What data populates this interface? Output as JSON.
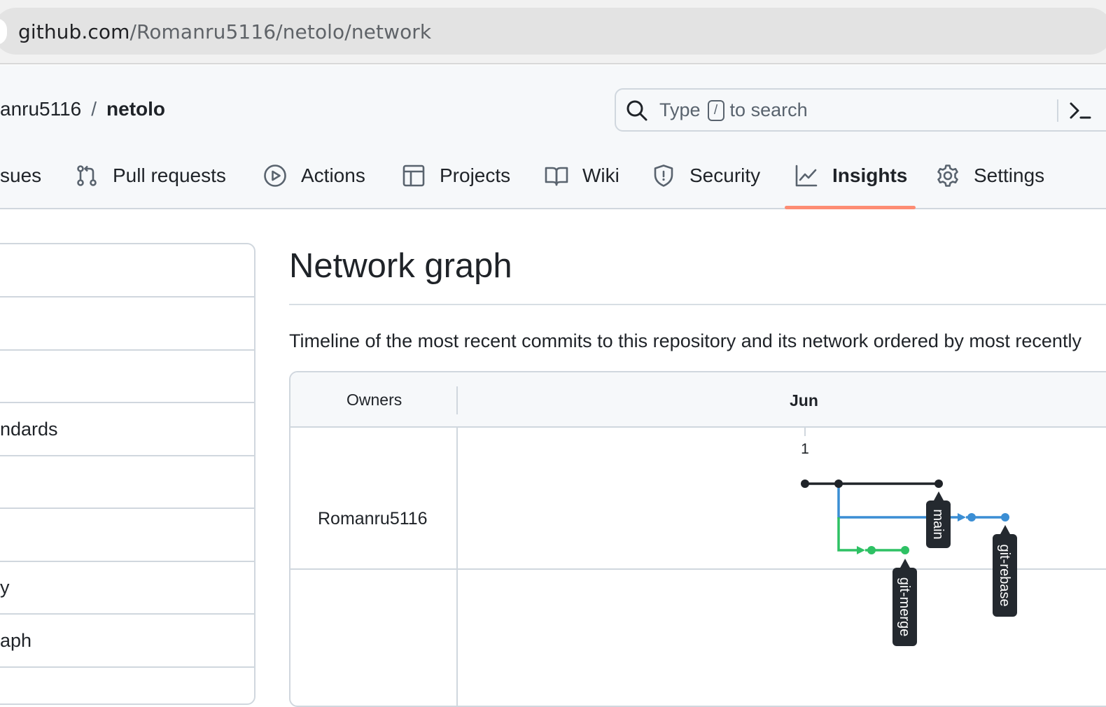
{
  "browser": {
    "url_host": "github.com",
    "url_path": "/Romanru5116/netolo/network"
  },
  "header": {
    "owner": "anru5116",
    "separator": "/",
    "repo": "netolo",
    "search": {
      "prefix": "Type",
      "key": "/",
      "suffix": "to search"
    }
  },
  "nav": {
    "items": [
      {
        "label": "sues",
        "icon": "issue-icon"
      },
      {
        "label": "Pull requests",
        "icon": "pull-request-icon"
      },
      {
        "label": "Actions",
        "icon": "play-icon"
      },
      {
        "label": "Projects",
        "icon": "table-icon"
      },
      {
        "label": "Wiki",
        "icon": "book-icon"
      },
      {
        "label": "Security",
        "icon": "shield-icon"
      },
      {
        "label": "Insights",
        "icon": "graph-icon",
        "active": true
      },
      {
        "label": "Settings",
        "icon": "gear-icon"
      }
    ],
    "active_color": "#fd8c73"
  },
  "sidebar": {
    "items": [
      {
        "label": ""
      },
      {
        "label": ""
      },
      {
        "label": ""
      },
      {
        "label": "ndards"
      },
      {
        "label": ""
      },
      {
        "label": ""
      },
      {
        "label": "y"
      },
      {
        "label": "aph"
      }
    ]
  },
  "main": {
    "title": "Network graph",
    "description": "Timeline of the most recent commits to this repository and its network ordered by most recently"
  },
  "graph": {
    "owners_header": "Owners",
    "month": "Jun",
    "day": "1",
    "owner": "Romanru5116",
    "branches": [
      {
        "name": "main",
        "color": "#1f2328"
      },
      {
        "name": "git-rebase",
        "color": "#3b8ed4"
      },
      {
        "name": "git-merge",
        "color": "#2ec164"
      }
    ]
  }
}
